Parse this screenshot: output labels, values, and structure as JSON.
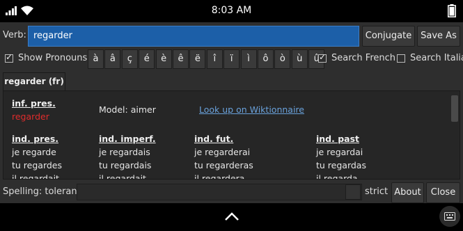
{
  "status": {
    "time": "8:03 AM"
  },
  "toolbar": {
    "verb_label": "Verb:",
    "verb_value": "regarder",
    "conjugate_label": "Conjugate",
    "save_as_label": "Save As"
  },
  "options": {
    "show_pronouns_label": "Show Pronouns",
    "show_pronouns_checked": true,
    "accents": [
      "à",
      "â",
      "ç",
      "é",
      "è",
      "ê",
      "ë",
      "î",
      "ï",
      "ì",
      "ô",
      "ò",
      "ù",
      "û"
    ],
    "search_french_label": "Search French",
    "search_french_checked": true,
    "search_italian_label": "Search Italia",
    "search_italian_checked": false
  },
  "tab": {
    "label": "regarder (fr)"
  },
  "conjugation": {
    "infinitive": {
      "header": "inf. pres.",
      "value": "regarder"
    },
    "model": "Model: aimer",
    "wiktionary_link": "Look up on Wiktionnaire",
    "ind_pres": {
      "header": "ind. pres.",
      "forms": [
        "je regarde",
        "tu regardes",
        "il regardait"
      ]
    },
    "ind_imperf": {
      "header": "ind. imperf.",
      "forms": [
        "je regardais",
        "tu regardais",
        "il regardait"
      ]
    },
    "ind_fut": {
      "header": "ind. fut.",
      "forms": [
        "je regarderai",
        "tu regarderas",
        "il regardera"
      ]
    },
    "ind_past": {
      "header": "ind. past",
      "forms": [
        "je regardai",
        "tu regardas",
        "il regarda"
      ]
    }
  },
  "bottom": {
    "spelling_label": "Spelling: tolerant",
    "strict_label": "strict",
    "about_label": "About",
    "close_label": "Close"
  },
  "icons": {
    "signal": "signal-icon",
    "wifi": "wifi-icon",
    "battery": "battery-icon",
    "nav_up": "chevron-up-icon",
    "keyboard": "keyboard-icon"
  }
}
